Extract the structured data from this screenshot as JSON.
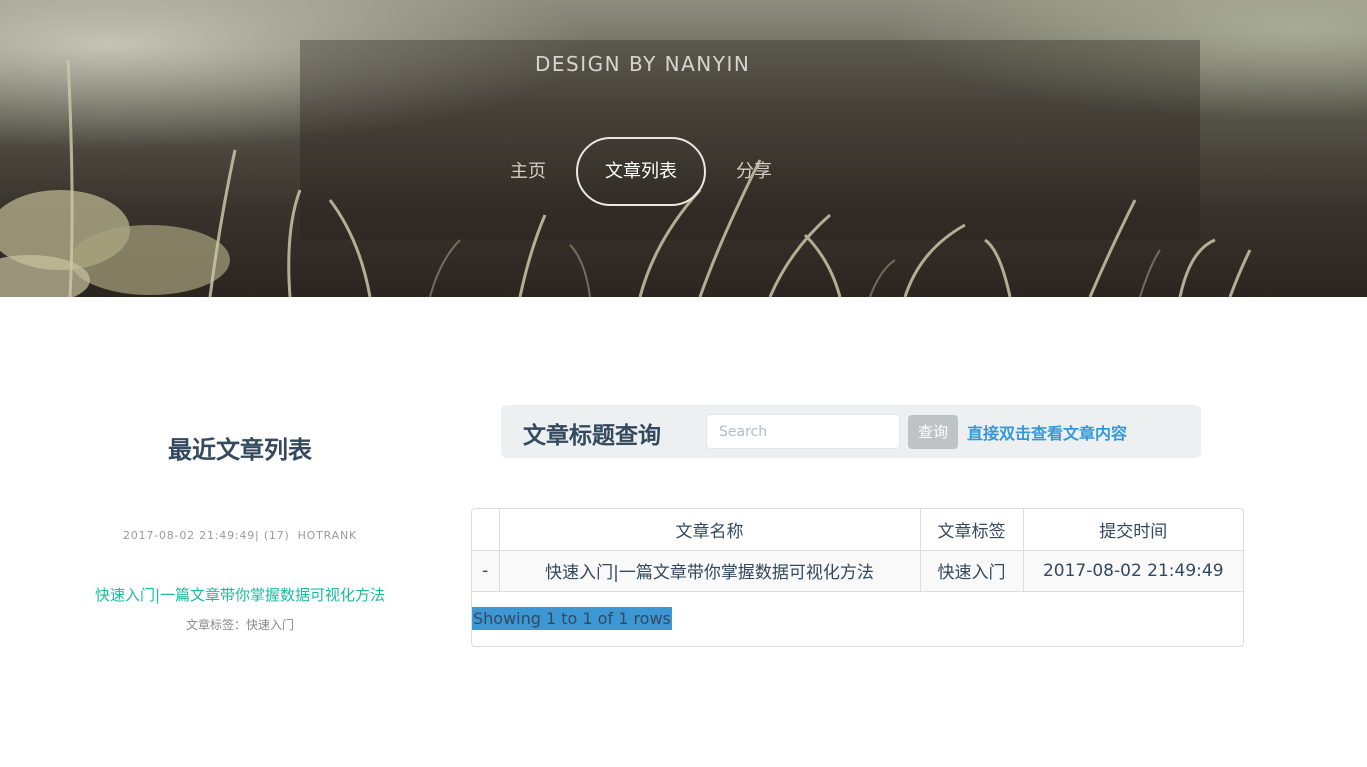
{
  "header": {
    "brand": "DESIGN BY NANYIN",
    "nav": [
      {
        "label": "主页",
        "active": false
      },
      {
        "label": "文章列表",
        "active": true
      },
      {
        "label": "分享",
        "active": false
      }
    ]
  },
  "sidebar": {
    "title": "最近文章列表",
    "post": {
      "meta": "2017-08-02 21:49:49| (17)",
      "author": "HOTRANK",
      "title": "快速入门|一篇文章带你掌握数据可视化方法",
      "tag_line": "文章标签：快速入门"
    }
  },
  "search": {
    "title": "文章标题查询",
    "placeholder": "Search",
    "button": "查询",
    "hint": "直接双击查看文章内容"
  },
  "table": {
    "columns": [
      "",
      "文章名称",
      "文章标签",
      "提交时间"
    ],
    "rows": [
      {
        "check": "-",
        "name": "快速入门|一篇文章带你掌握数据可视化方法",
        "tag": "快速入门",
        "time": "2017-08-02 21:49:49"
      }
    ],
    "pagination": "Showing 1 to 1 of 1 rows"
  },
  "colors": {
    "accent_green": "#1abc9c",
    "accent_blue": "#3498db",
    "heading": "#34495e",
    "button_gray": "#bdc3c7"
  }
}
